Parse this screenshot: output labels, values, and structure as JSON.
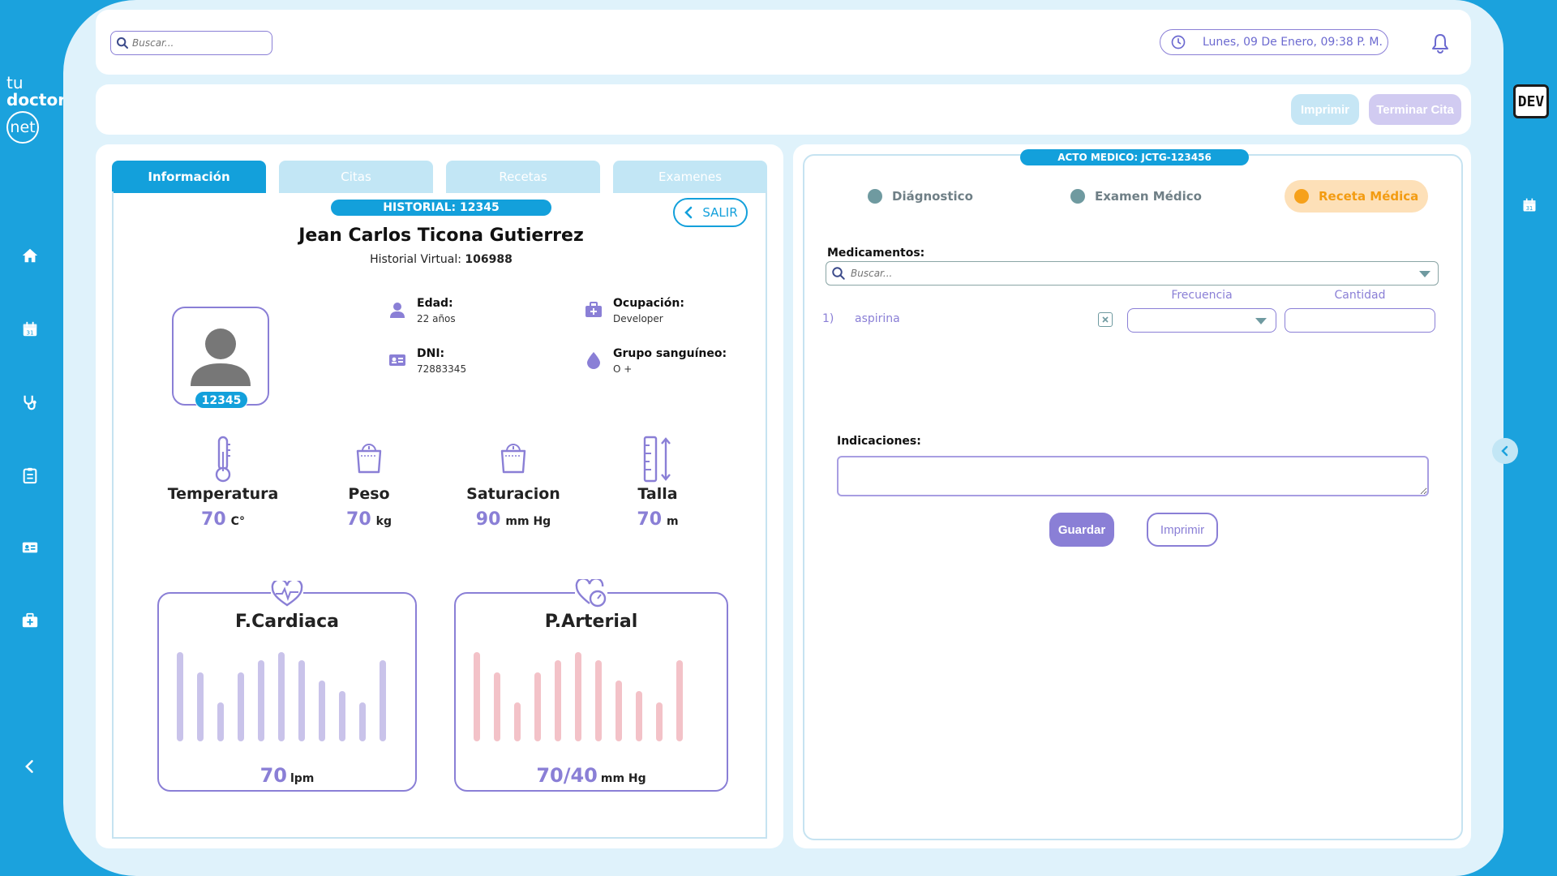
{
  "app": {
    "logo": {
      "line1": "tu",
      "line2": "doctor",
      "line3": "net"
    },
    "dev_badge": "DEV"
  },
  "colors": {
    "primary": "#13a0db",
    "accent": "#8a7fd6",
    "active_step": "#f39c12",
    "chart_fc": "#c9c3ea",
    "chart_pa": "#f3c2c8"
  },
  "sidebar": {
    "items": [
      {
        "icon": "home-icon"
      },
      {
        "icon": "calendar-icon"
      },
      {
        "icon": "stethoscope-icon"
      },
      {
        "icon": "clipboard-icon"
      },
      {
        "icon": "id-card-icon"
      },
      {
        "icon": "medkit-icon"
      }
    ],
    "collapse_icon": "chevron-left-icon"
  },
  "topbar": {
    "search_placeholder": "Buscar...",
    "datetime": "Lunes, 09 De Enero, 09:38 P. M."
  },
  "actionbar": {
    "print_label": "Imprimir",
    "end_label": "Terminar Cita"
  },
  "tabs": [
    {
      "label": "Información",
      "active": true
    },
    {
      "label": "Citas",
      "active": false
    },
    {
      "label": "Recetas",
      "active": false
    },
    {
      "label": "Examenes",
      "active": false
    }
  ],
  "patient": {
    "historial_badge": "HISTORIAL: 12345",
    "exit_label": "SALIR",
    "name": "Jean Carlos Ticona Gutierrez",
    "virtual_label": "Historial Virtual:",
    "virtual_value": "106988",
    "avatar_id": "12345",
    "info": {
      "age_label": "Edad:",
      "age_value": "22 años",
      "occupation_label": "Ocupación:",
      "occupation_value": "Developer",
      "dni_label": "DNI:",
      "dni_value": "72883345",
      "blood_label": "Grupo sanguíneo:",
      "blood_value": "O +"
    }
  },
  "vitals": [
    {
      "label": "Temperatura",
      "value": "70",
      "unit": "C°",
      "icon": "thermometer-icon"
    },
    {
      "label": "Peso",
      "value": "70",
      "unit": "kg",
      "icon": "scale-icon"
    },
    {
      "label": "Saturacion",
      "value": "90",
      "unit": "mm Hg",
      "icon": "scale-icon"
    },
    {
      "label": "Talla",
      "value": "70",
      "unit": "m",
      "icon": "height-icon"
    }
  ],
  "cards": {
    "fc": {
      "title": "F.Cardiaca",
      "value": "70",
      "unit": "lpm"
    },
    "pa": {
      "title": "P.Arterial",
      "value": "70/40",
      "unit": "mm Hg"
    }
  },
  "chart_data": [
    {
      "type": "bar",
      "title": "F.Cardiaca",
      "values": [
        110,
        85,
        48,
        85,
        100,
        110,
        100,
        75,
        62,
        48,
        100
      ]
    },
    {
      "type": "bar",
      "title": "P.Arterial",
      "values": [
        110,
        85,
        48,
        85,
        100,
        110,
        100,
        75,
        62,
        48,
        100
      ]
    }
  ],
  "consult": {
    "acto_badge": "ACTO MEDICO: JCTG-123456",
    "steps": [
      {
        "label": "Diágnostico",
        "active": false
      },
      {
        "label": "Examen Médico",
        "active": false
      },
      {
        "label": "Receta Médica",
        "active": true
      }
    ],
    "medicamentos_label": "Medicamentos:",
    "search_placeholder": "Buscar...",
    "col_frecuencia": "Frecuencia",
    "col_cantidad": "Cantidad",
    "meds": [
      {
        "index": "1)",
        "name": "aspirina"
      }
    ],
    "indicaciones_label": "Indicaciones:",
    "save_label": "Guardar",
    "print_label": "Imprimir"
  }
}
